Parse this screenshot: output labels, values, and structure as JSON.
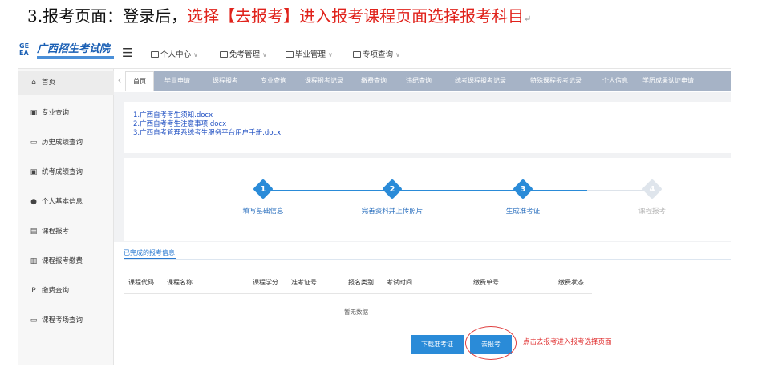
{
  "doc": {
    "heading_prefix": "3.报考页面：登录后，",
    "heading_red": "选择【去报考】进入报考课程页面选择报考科目",
    "return_mark": "↵"
  },
  "logo": {
    "mark": "GE EA",
    "text": "广西招生考试院"
  },
  "topnav": {
    "menu_icon": "hamburger-icon",
    "items": [
      {
        "label": "个人中心"
      },
      {
        "label": "免考管理"
      },
      {
        "label": "毕业管理"
      },
      {
        "label": "专项查询"
      }
    ]
  },
  "sidebar": {
    "items": [
      {
        "icon": "home-icon",
        "glyph": "⌂",
        "label": "首页"
      },
      {
        "icon": "calendar-icon",
        "glyph": "▣",
        "label": "专业查询"
      },
      {
        "icon": "file-icon",
        "glyph": "▭",
        "label": "历史成绩查询"
      },
      {
        "icon": "calendar-icon",
        "glyph": "▣",
        "label": "统考成绩查询"
      },
      {
        "icon": "user-icon",
        "glyph": "●",
        "label": "个人基本信息"
      },
      {
        "icon": "card-icon",
        "glyph": "▤",
        "label": "课程报考"
      },
      {
        "icon": "bar-chart-icon",
        "glyph": "▥",
        "label": "课程报考缴费"
      },
      {
        "icon": "paypal-icon",
        "glyph": "P",
        "label": "缴费查询"
      },
      {
        "icon": "folder-icon",
        "glyph": "▭",
        "label": "课程考场查询"
      }
    ]
  },
  "tabs": {
    "items": [
      {
        "label": "首页"
      },
      {
        "label": "毕业申请"
      },
      {
        "label": "课程报考"
      },
      {
        "label": "专业查询"
      },
      {
        "label": "课程报考记录"
      },
      {
        "label": "缴费查询"
      },
      {
        "label": "违纪查询"
      },
      {
        "label": "统考课程报考记录"
      },
      {
        "label": "特殊课程报考记录"
      },
      {
        "label": "个人信息"
      },
      {
        "label": "学历成果认证申请"
      }
    ]
  },
  "documents": [
    {
      "label": "1.广西自考考生须知.docx"
    },
    {
      "label": "2.广西自考考生注意事项.docx"
    },
    {
      "label": "3.广西自考管理系统考生服务平台用户手册.docx"
    }
  ],
  "steps": [
    {
      "num": "1",
      "label": "填写基础信息",
      "done": true
    },
    {
      "num": "2",
      "label": "完善资料并上传照片",
      "done": true
    },
    {
      "num": "3",
      "label": "生成准考证",
      "done": true
    },
    {
      "num": "4",
      "label": "课程报考",
      "done": false
    }
  ],
  "completed": {
    "title": "已完成的报考信息",
    "columns": [
      "课程代码",
      "课程名称",
      "课程学分",
      "准考证号",
      "报名类别",
      "考试时间",
      "缴费单号",
      "缴费状态"
    ],
    "empty_text": "暂无数据"
  },
  "actions": {
    "download_label": "下载准考证",
    "apply_label": "去报考",
    "annotation": "点击去报考进入报考选择页面"
  },
  "colors": {
    "accent": "#2a8bd8",
    "tab_bar": "#a6b3c6",
    "annotation": "#e03030"
  }
}
